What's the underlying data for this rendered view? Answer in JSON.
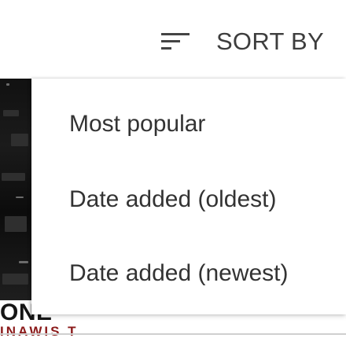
{
  "header": {
    "title": "SORT BY",
    "icon": "sort-icon"
  },
  "menu": {
    "items": [
      {
        "label": "Most popular"
      },
      {
        "label": "Date added (oldest)"
      },
      {
        "label": "Date added (newest)"
      }
    ]
  },
  "background": {
    "video_title_fragment": "ONE",
    "channel_fragment": "INAWIS T ANTAN"
  },
  "colors": {
    "text": "#333333",
    "channel": "#8b1a1a",
    "background": "#ffffff"
  }
}
